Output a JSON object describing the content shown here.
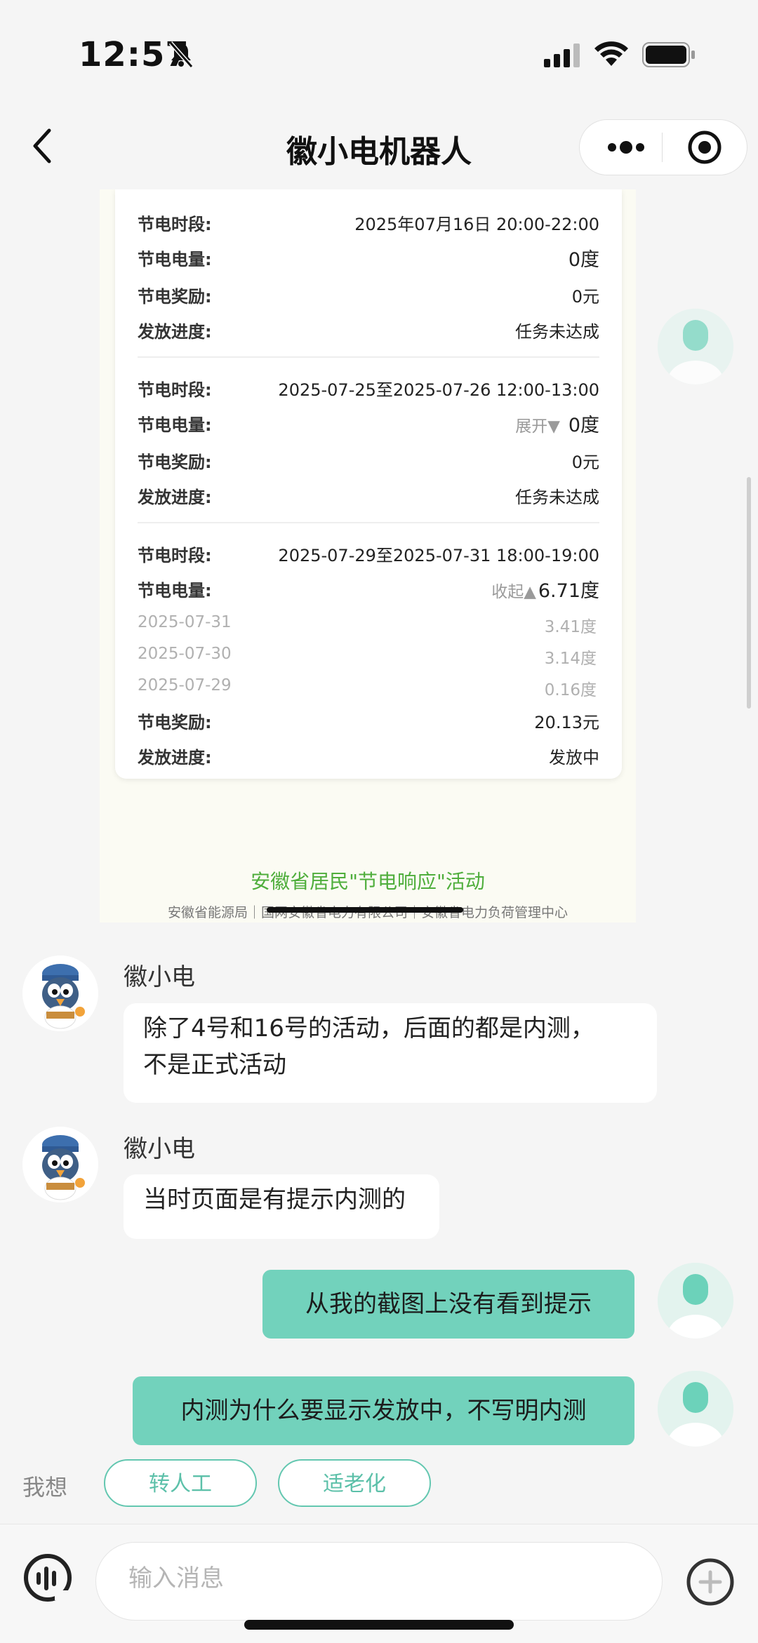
{
  "status_bar": {
    "time": "12:57"
  },
  "nav": {
    "title": "徽小电机器人"
  },
  "card": {
    "records": [
      {
        "period_label": "节电时段:",
        "period": "2025年07月16日 20:00-22:00",
        "amount_label": "节电电量:",
        "amount": "0度",
        "reward_label": "节电奖励:",
        "reward": "0元",
        "progress_label": "发放进度:",
        "progress": "任务未达成"
      },
      {
        "period_label": "节电时段:",
        "period": "2025-07-25至2025-07-26 12:00-13:00",
        "amount_label": "节电电量:",
        "toggle": "展开▼",
        "amount": "0度",
        "reward_label": "节电奖励:",
        "reward": "0元",
        "progress_label": "发放进度:",
        "progress": "任务未达成"
      },
      {
        "period_label": "节电时段:",
        "period": "2025-07-29至2025-07-31 18:00-19:00",
        "amount_label": "节电电量:",
        "toggle": "收起▲",
        "amount": "6.71度",
        "daily": [
          {
            "date": "2025-07-31",
            "value": "3.41度"
          },
          {
            "date": "2025-07-30",
            "value": "3.14度"
          },
          {
            "date": "2025-07-29",
            "value": "0.16度"
          }
        ],
        "reward_label": "节电奖励:",
        "reward": "20.13元",
        "progress_label": "发放进度:",
        "progress": "发放中"
      }
    ],
    "activity_title": "安徽省居民\"节电响应\"活动",
    "sponsors": "安徽省能源局｜国网安徽省电力有限公司｜安徽省电力负荷管理中心"
  },
  "messages": [
    {
      "sender": "徽小电",
      "lines": [
        "除了4号和16号的活动，后面的都是内测，",
        "不是正式活动"
      ]
    },
    {
      "sender": "徽小电",
      "lines": [
        "当时页面是有提示内测的"
      ]
    },
    {
      "sender": "user",
      "text": "从我的截图上没有看到提示"
    },
    {
      "sender": "user",
      "text": "内测为什么要显示发放中，不写明内测"
    }
  ],
  "quick_actions": {
    "label": "我想",
    "chips": [
      "转人工",
      "适老化"
    ]
  },
  "input": {
    "placeholder": "输入消息"
  },
  "colors": {
    "user_bubble": "#72d2bc",
    "accent": "#5cc0a9",
    "activity_green": "#4fae3c"
  }
}
